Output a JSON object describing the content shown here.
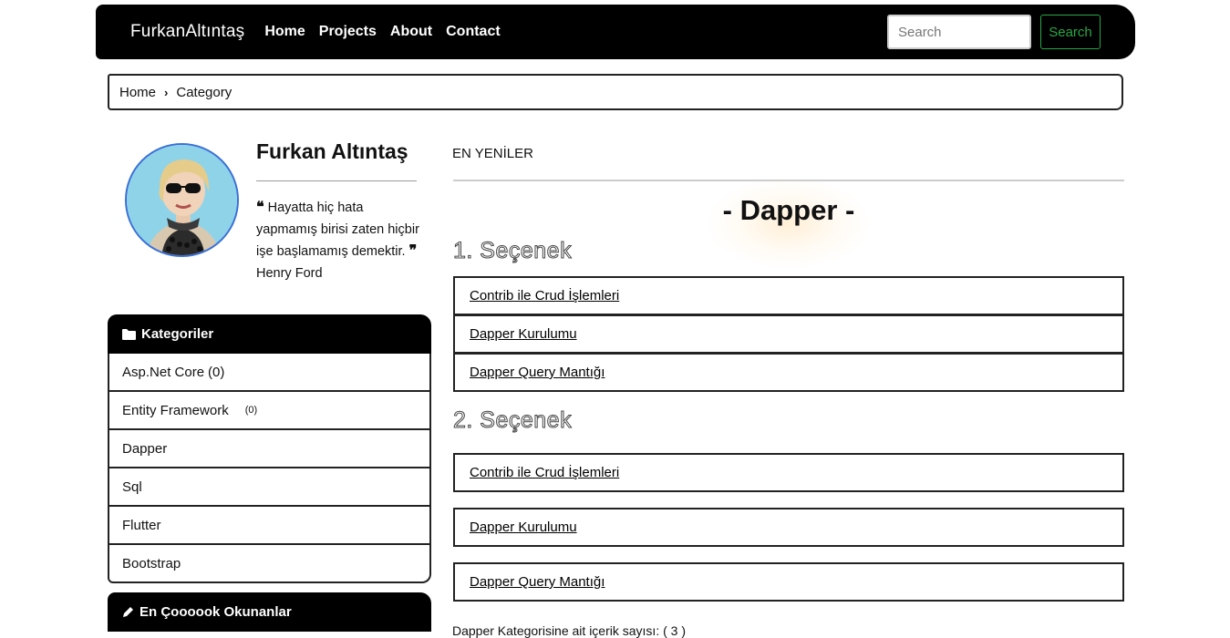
{
  "navbar": {
    "brand": "FurkanAltıntaş",
    "links": [
      "Home",
      "Projects",
      "About",
      "Contact"
    ],
    "search_placeholder": "Search",
    "search_button": "Search"
  },
  "breadcrumb": {
    "home": "Home",
    "separator": "›",
    "current": "Category"
  },
  "profile": {
    "name": "Furkan Altıntaş",
    "quote_open": "❝",
    "quote": "Hayatta hiç hata yapmamış birisi zaten hiçbir işe başlamamış demektir.",
    "quote_close": "❞",
    "author": "Henry Ford"
  },
  "categories": {
    "title": "Kategoriler",
    "icon": "folder-icon",
    "items": [
      {
        "label": "Asp.Net Core",
        "count": "(0)"
      },
      {
        "label": "Entity Framework",
        "count": "(0)"
      },
      {
        "label": "Dapper",
        "count": ""
      },
      {
        "label": "Sql",
        "count": ""
      },
      {
        "label": "Flutter",
        "count": ""
      },
      {
        "label": "Bootstrap",
        "count": ""
      }
    ]
  },
  "popular": {
    "title": "En Çoooook Okunanlar",
    "icon": "pencil-icon"
  },
  "main": {
    "latest_label": "EN YENİLER",
    "title": "- Dapper -",
    "options": [
      {
        "title": "1. Seçenek",
        "links": [
          "Contrib ile Crud İşlemleri",
          "Dapper Kurulumu",
          "Dapper Query Mantığı"
        ]
      },
      {
        "title": "2. Seçenek",
        "links": [
          "Contrib ile Crud İşlemleri",
          "Dapper Kurulumu",
          "Dapper Query Mantığı"
        ]
      }
    ],
    "count_text": "Dapper Kategorisine ait içerik sayısı: ( 3 )"
  },
  "colors": {
    "accent_green": "#28a745",
    "avatar_ring": "#3b6fd6"
  }
}
